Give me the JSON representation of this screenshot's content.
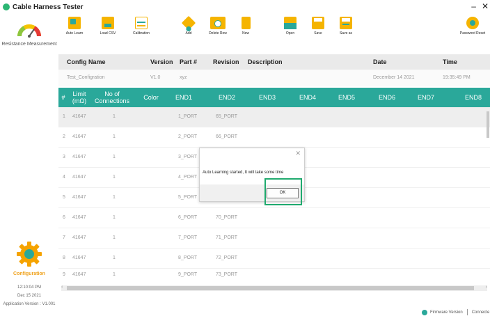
{
  "app": {
    "title": "Cable Harness Tester"
  },
  "window": {
    "minimize": "–",
    "close": "✕"
  },
  "sidebar": {
    "resistance_label": "Resistance Measurement",
    "config_label": "Configuration",
    "time": "12:10:04 PM",
    "date": "Dec 15 2021",
    "app_version": "Application Version : V1.001"
  },
  "toolbar": {
    "auto_learn": "Auto Learn",
    "load_csv": "Load CSV",
    "calibration": "Calibration",
    "add": "Add",
    "delete_row": "Delete Row",
    "new": "New",
    "open": "Open",
    "save": "Save",
    "save_as": "Save as",
    "password_reset": "Password Reset"
  },
  "config": {
    "headers": {
      "name": "Config Name",
      "version": "Version",
      "part": "Part #",
      "revision": "Revision",
      "description": "Description",
      "date": "Date",
      "time": "Time"
    },
    "values": {
      "name": "Test_Configration",
      "version": "V1.0",
      "part": "xyz",
      "revision": "",
      "description": "",
      "date": "December 14 2021",
      "time": "19:35:49 PM"
    }
  },
  "grid": {
    "headers": {
      "num": "#",
      "limit": "Limit (mΩ)",
      "connections": "No of Connections",
      "color": "Color",
      "end1": "END1",
      "end2": "END2",
      "end3": "END3",
      "end4": "END4",
      "end5": "END5",
      "end6": "END6",
      "end7": "END7",
      "end8": "END8"
    },
    "rows": [
      {
        "num": "1",
        "limit": "41647",
        "connections": "1",
        "end1": "1_PORT",
        "end2": "65_PORT"
      },
      {
        "num": "2",
        "limit": "41647",
        "connections": "1",
        "end1": "2_PORT",
        "end2": "66_PORT"
      },
      {
        "num": "3",
        "limit": "41647",
        "connections": "1",
        "end1": "3_PORT",
        "end2": ""
      },
      {
        "num": "4",
        "limit": "41647",
        "connections": "1",
        "end1": "4_PORT",
        "end2": ""
      },
      {
        "num": "5",
        "limit": "41647",
        "connections": "1",
        "end1": "5_PORT",
        "end2": ""
      },
      {
        "num": "6",
        "limit": "41647",
        "connections": "1",
        "end1": "6_PORT",
        "end2": "70_PORT"
      },
      {
        "num": "7",
        "limit": "41647",
        "connections": "1",
        "end1": "7_PORT",
        "end2": "71_PORT"
      },
      {
        "num": "8",
        "limit": "41647",
        "connections": "1",
        "end1": "8_PORT",
        "end2": "72_PORT"
      },
      {
        "num": "9",
        "limit": "41647",
        "connections": "1",
        "end1": "9_PORT",
        "end2": "73_PORT"
      }
    ]
  },
  "status": {
    "firmware": "Firmware Version",
    "connection": "Connecte"
  },
  "dialog": {
    "close": "✕",
    "message": "Auto Learning started, It will take some time",
    "ok": "OK"
  },
  "colors": {
    "accent": "#2aa89a",
    "toolbar_icon": "#f5b400",
    "highlight": "#1faa6e",
    "config_text": "#f0a21c"
  }
}
